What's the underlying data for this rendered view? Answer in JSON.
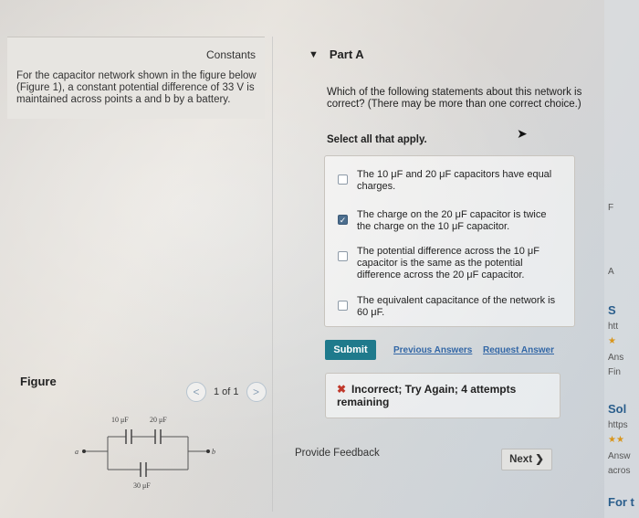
{
  "left": {
    "constants_tab": "Constants",
    "problem_text": "For the capacitor network shown in the figure below (Figure 1), a constant potential difference of 33 V is maintained across points a and b by a battery.",
    "figure_header": "Figure",
    "pager": {
      "prev": "<",
      "count": "1 of 1",
      "next": ">"
    },
    "figure": {
      "cap1": "10 μF",
      "cap2": "20 μF",
      "cap3": "30 μF",
      "node_a": "a",
      "node_b": "b"
    }
  },
  "part_a": {
    "caret": "▼",
    "title": "Part A",
    "question": "Which of the following statements about this network is correct? (There may be more than one correct choice.)",
    "instruction": "Select all that apply.",
    "options": [
      {
        "text": "The 10 μF and 20 μF capacitors have equal charges.",
        "checked": false
      },
      {
        "text": "The charge on the 20 μF capacitor is twice the charge on the 10 μF capacitor.",
        "checked": true
      },
      {
        "text": "The potential difference across the 10 μF capacitor is the same as the potential difference across the 20 μF capacitor.",
        "checked": false
      },
      {
        "text": "The equivalent capacitance of the network is 60 μF.",
        "checked": false
      }
    ],
    "submit_label": "Submit",
    "previous_answers": "Previous Answers",
    "request_answer": "Request Answer",
    "feedback_icon": "✖",
    "feedback_text": "Incorrect; Try Again; 4 attempts remaining",
    "provide_feedback": "Provide Feedback",
    "next_label": "Next ❯"
  },
  "edge": [
    "F",
    "A",
    "S",
    "htt",
    "★",
    "Ans",
    "Fin",
    "Sol",
    "https",
    "★★",
    "Answ",
    "acros",
    "For t"
  ],
  "colors": {
    "submit": "#1f7a8c",
    "link": "#3367a6",
    "error": "#c0392b",
    "checked": "#4c6e8e"
  }
}
